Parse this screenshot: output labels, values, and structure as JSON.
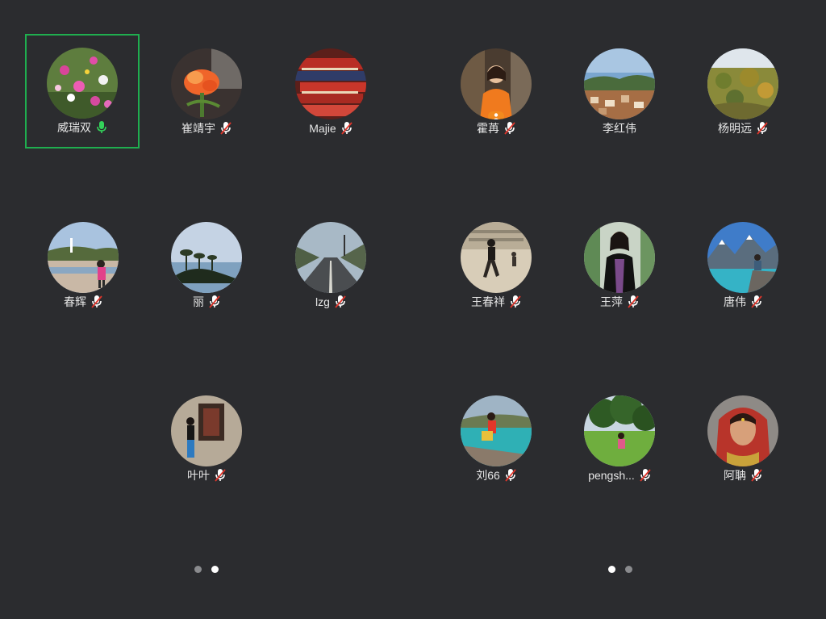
{
  "participants": [
    {
      "name": "威瑞双",
      "mic": "on",
      "speaking": true
    },
    {
      "name": "崔靖宇",
      "mic": "muted"
    },
    {
      "name": "Majie",
      "mic": "muted"
    },
    {
      "name": "霍苒",
      "mic": "muted",
      "host": true
    },
    {
      "name": "李红伟",
      "mic": "none"
    },
    {
      "name": "杨明远",
      "mic": "muted"
    },
    {
      "name": "春辉",
      "mic": "muted"
    },
    {
      "name": "丽",
      "mic": "muted"
    },
    {
      "name": "lzg",
      "mic": "muted"
    },
    {
      "name": "王春祥",
      "mic": "muted"
    },
    {
      "name": "王萍",
      "mic": "muted"
    },
    {
      "name": "唐伟",
      "mic": "muted"
    },
    {
      "name": "叶叶",
      "mic": "muted"
    },
    {
      "name": "刘66",
      "mic": "muted"
    },
    {
      "name": "pengsh...",
      "mic": "muted"
    },
    {
      "name": "阿聃",
      "mic": "muted"
    }
  ],
  "pager_left": {
    "count": 2,
    "active": 2
  },
  "pager_right": {
    "count": 2,
    "active": 1
  },
  "colors": {
    "background": "#2b2c2f",
    "speaking_border": "#1fae4f",
    "mic_on": "#33d35a",
    "mic_muted_slash": "#e0352b",
    "text": "#e6e6e6"
  },
  "icons": {
    "mic_on": "microphone-icon",
    "mic_muted": "microphone-muted-icon",
    "host_badge": "host-person-icon"
  }
}
